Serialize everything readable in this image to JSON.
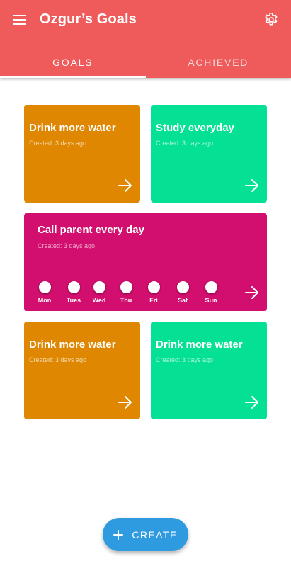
{
  "app": {
    "title": "Ozgur’s Goals"
  },
  "icons": {
    "menu": "menu-icon",
    "settings": "gear-icon",
    "arrow": "arrow-right-icon",
    "create": "plus-icon"
  },
  "colors": {
    "appbar": "#ef5b5b",
    "orange": "#df8700",
    "green": "#04e194",
    "magenta": "#d20e6e",
    "fab": "#2e9ae0"
  },
  "tabs": [
    {
      "label": "GOALS",
      "active": true
    },
    {
      "label": "ACHIEVED",
      "active": false
    }
  ],
  "goals": [
    {
      "title": "Drink more water",
      "created": "Created: 3 days ago",
      "color": "orange"
    },
    {
      "title": "Study everyday",
      "created": "Created: 3 days ago",
      "color": "green"
    },
    {
      "title": "Call parent every day",
      "created": "Created: 3 days ago",
      "color": "magenta",
      "days": [
        "Mon",
        "Tues",
        "Wed",
        "Thu",
        "Fri",
        "Sat",
        "Sun"
      ]
    },
    {
      "title": "Drink more water",
      "created": "Created: 3 days ago",
      "color": "orange"
    },
    {
      "title": "Drink more water",
      "created": "Created: 3 days ago",
      "color": "green"
    }
  ],
  "fab": {
    "label": "CREATE"
  }
}
